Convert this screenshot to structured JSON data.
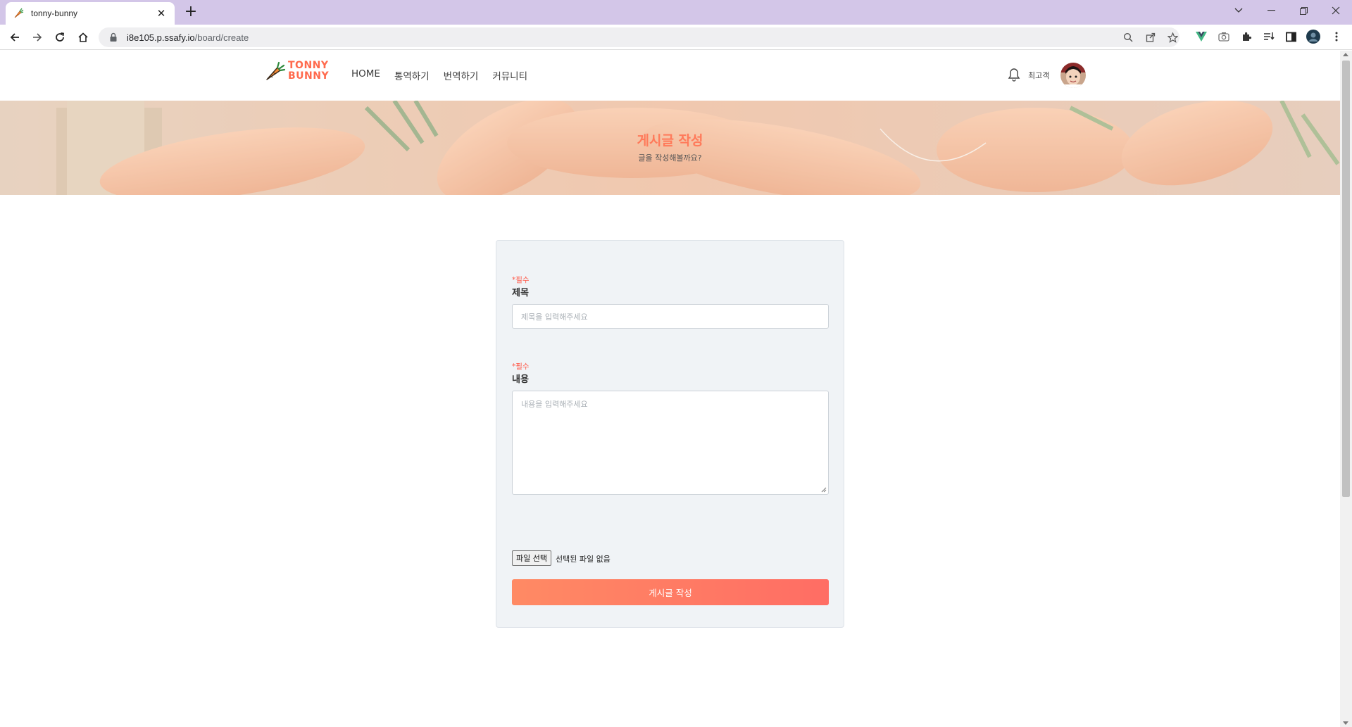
{
  "browser": {
    "tab_title": "tonny-bunny",
    "tab_close": "✕",
    "new_tab": "+",
    "url_host": "i8e105.p.ssafy.io",
    "url_path": "/board/create"
  },
  "site": {
    "logo_line1": "TONNY",
    "logo_line2": "BUNNY",
    "nav": [
      "HOME",
      "통역하기",
      "번역하기",
      "커뮤니티"
    ],
    "username": "최고객",
    "accent_color": "#ff7a5a"
  },
  "hero": {
    "title": "게시글 작성",
    "subtitle": "글을 작성해볼까요?"
  },
  "form": {
    "title_required": "*필수",
    "title_label": "제목",
    "title_placeholder": "제목을 입력해주세요",
    "content_required": "*필수",
    "content_label": "내용",
    "content_placeholder": "내용을 입력해주세요",
    "file_button": "파일 선택",
    "file_status": "선택된 파일 없음",
    "submit_label": "게시글 작성"
  }
}
